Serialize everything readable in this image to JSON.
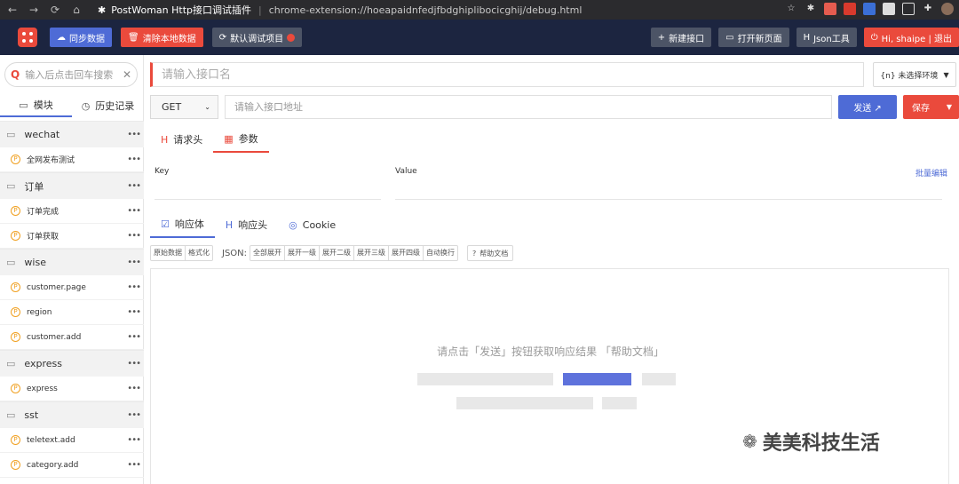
{
  "browser": {
    "ext_title": "PostWoman Http接口调试插件",
    "url": "chrome-extension://hoeapaidnfedjfbdghiplibocicghij/debug.html"
  },
  "header": {
    "sync_label": "同步数据",
    "clear_label": "清除本地数据",
    "default_project_label": "默认调试项目",
    "new_api_label": "新建接口",
    "open_page_label": "打开新页面",
    "json_tool_label": "Json工具",
    "user_label": "Hi, shaipe | 退出"
  },
  "sidebar": {
    "search_placeholder": "输入后点击回车搜索",
    "tab_modules": "模块",
    "tab_history": "历史记录",
    "groups": [
      {
        "name": "wechat",
        "items": [
          "全网发布测试"
        ]
      },
      {
        "name": "订单",
        "items": [
          "订单完成",
          "订单获取"
        ]
      },
      {
        "name": "wise",
        "items": [
          "customer.page",
          "region",
          "customer.add"
        ]
      },
      {
        "name": "express",
        "items": [
          "express"
        ]
      },
      {
        "name": "sst",
        "items": [
          "teletext.add",
          "category.add"
        ]
      }
    ]
  },
  "request": {
    "name_placeholder": "请输入接口名",
    "env_label": "{n} 未选择环境",
    "method": "GET",
    "url_placeholder": "请输入接口地址",
    "send_label": "发送 ↗",
    "save_label": "保存",
    "tab_headers": "请求头",
    "tab_params": "参数",
    "key_label": "Key",
    "value_label": "Value",
    "bulk_edit": "批量编辑"
  },
  "response": {
    "tab_body": "响应体",
    "tab_headers": "响应头",
    "tab_cookie": "Cookie",
    "raw_label": "原始数据",
    "format_label": "格式化",
    "json_label": "JSON:",
    "expand_all": "全部展开",
    "expand_1": "展开一级",
    "expand_2": "展开二级",
    "expand_3": "展开三级",
    "expand_4": "展开四级",
    "auto_wrap": "自动换行",
    "help_label": "帮助文档",
    "hint": "请点击「发送」按钮获取响应结果 「帮助文档」"
  },
  "watermark": "美美科技生活"
}
